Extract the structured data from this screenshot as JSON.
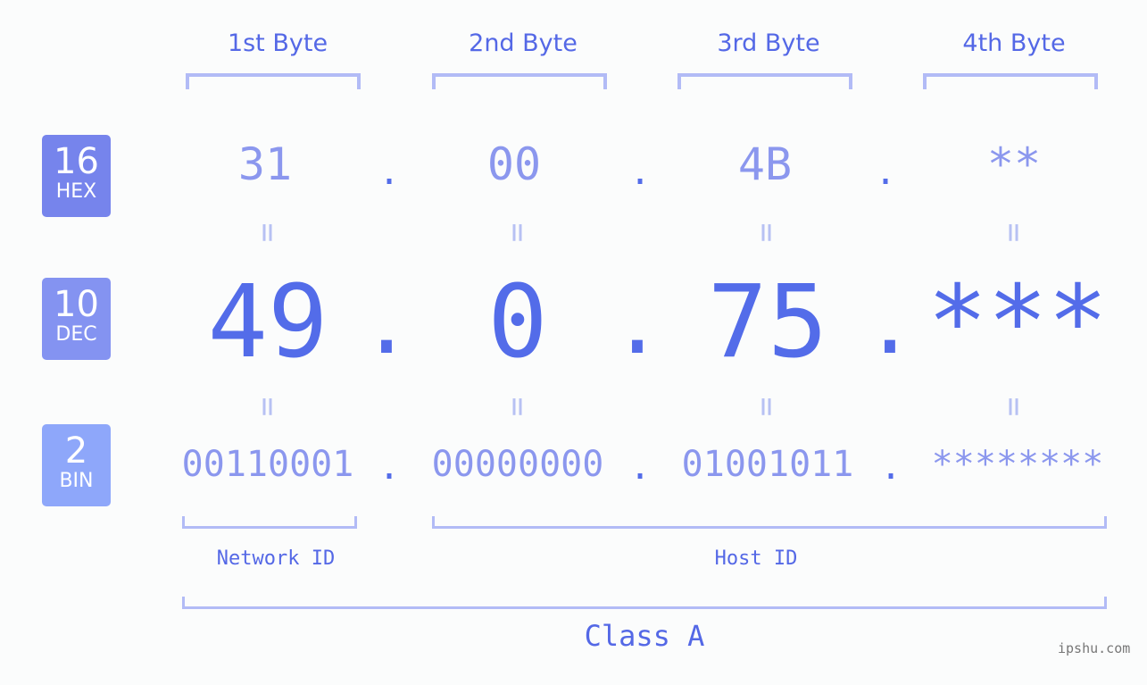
{
  "bytes": [
    {
      "label": "1st Byte",
      "hex": "31",
      "dec": "49",
      "bin": "00110001"
    },
    {
      "label": "2nd Byte",
      "hex": "00",
      "dec": "0",
      "bin": "00000000"
    },
    {
      "label": "3rd Byte",
      "hex": "4B",
      "dec": "75",
      "bin": "01001011"
    },
    {
      "label": "4th Byte",
      "hex": "**",
      "dec": "***",
      "bin": "********"
    }
  ],
  "badges": {
    "hex": {
      "num": "16",
      "base": "HEX",
      "color": "#7684ec"
    },
    "dec": {
      "num": "10",
      "base": "DEC",
      "color": "#8493f1"
    },
    "bin": {
      "num": "2",
      "base": "BIN",
      "color": "#8ea7fa"
    }
  },
  "separator": ".",
  "equals": "=",
  "network_label": "Network ID",
  "host_label": "Host ID",
  "class_label": "Class A",
  "watermark": "ipshu.com"
}
